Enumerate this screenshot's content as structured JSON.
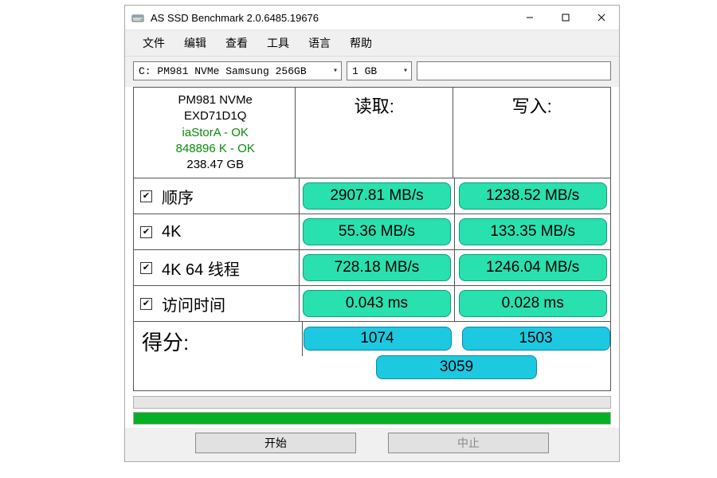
{
  "titlebar": {
    "title": "AS SSD Benchmark 2.0.6485.19676"
  },
  "menu": {
    "file": "文件",
    "edit": "编辑",
    "view": "查看",
    "tool": "工具",
    "lang": "语言",
    "help": "帮助"
  },
  "toolbar": {
    "drive_select": "C: PM981 NVMe Samsung 256GB",
    "size_select": "1 GB"
  },
  "info": {
    "model": "PM981 NVMe",
    "firmware": "EXD71D1Q",
    "driver": "iaStorA - OK",
    "align": "848896 K - OK",
    "capacity": "238.47 GB"
  },
  "headers": {
    "read": "读取:",
    "write": "写入:"
  },
  "tests": {
    "seq": {
      "label": "顺序",
      "read": "2907.81 MB/s",
      "write": "1238.52 MB/s"
    },
    "fk": {
      "label": "4K",
      "read": "55.36 MB/s",
      "write": "133.35 MB/s"
    },
    "fk64": {
      "label": "4K 64 线程",
      "read": "728.18 MB/s",
      "write": "1246.04 MB/s"
    },
    "access": {
      "label": "访问时间",
      "read": "0.043 ms",
      "write": "0.028 ms"
    }
  },
  "score": {
    "label": "得分:",
    "read": "1074",
    "write": "1503",
    "total": "3059"
  },
  "buttons": {
    "start": "开始",
    "stop": "中止"
  },
  "colors": {
    "result_pill": "#29e0af",
    "score_pill": "#1cc9e0",
    "progress_fill": "#06b025"
  }
}
